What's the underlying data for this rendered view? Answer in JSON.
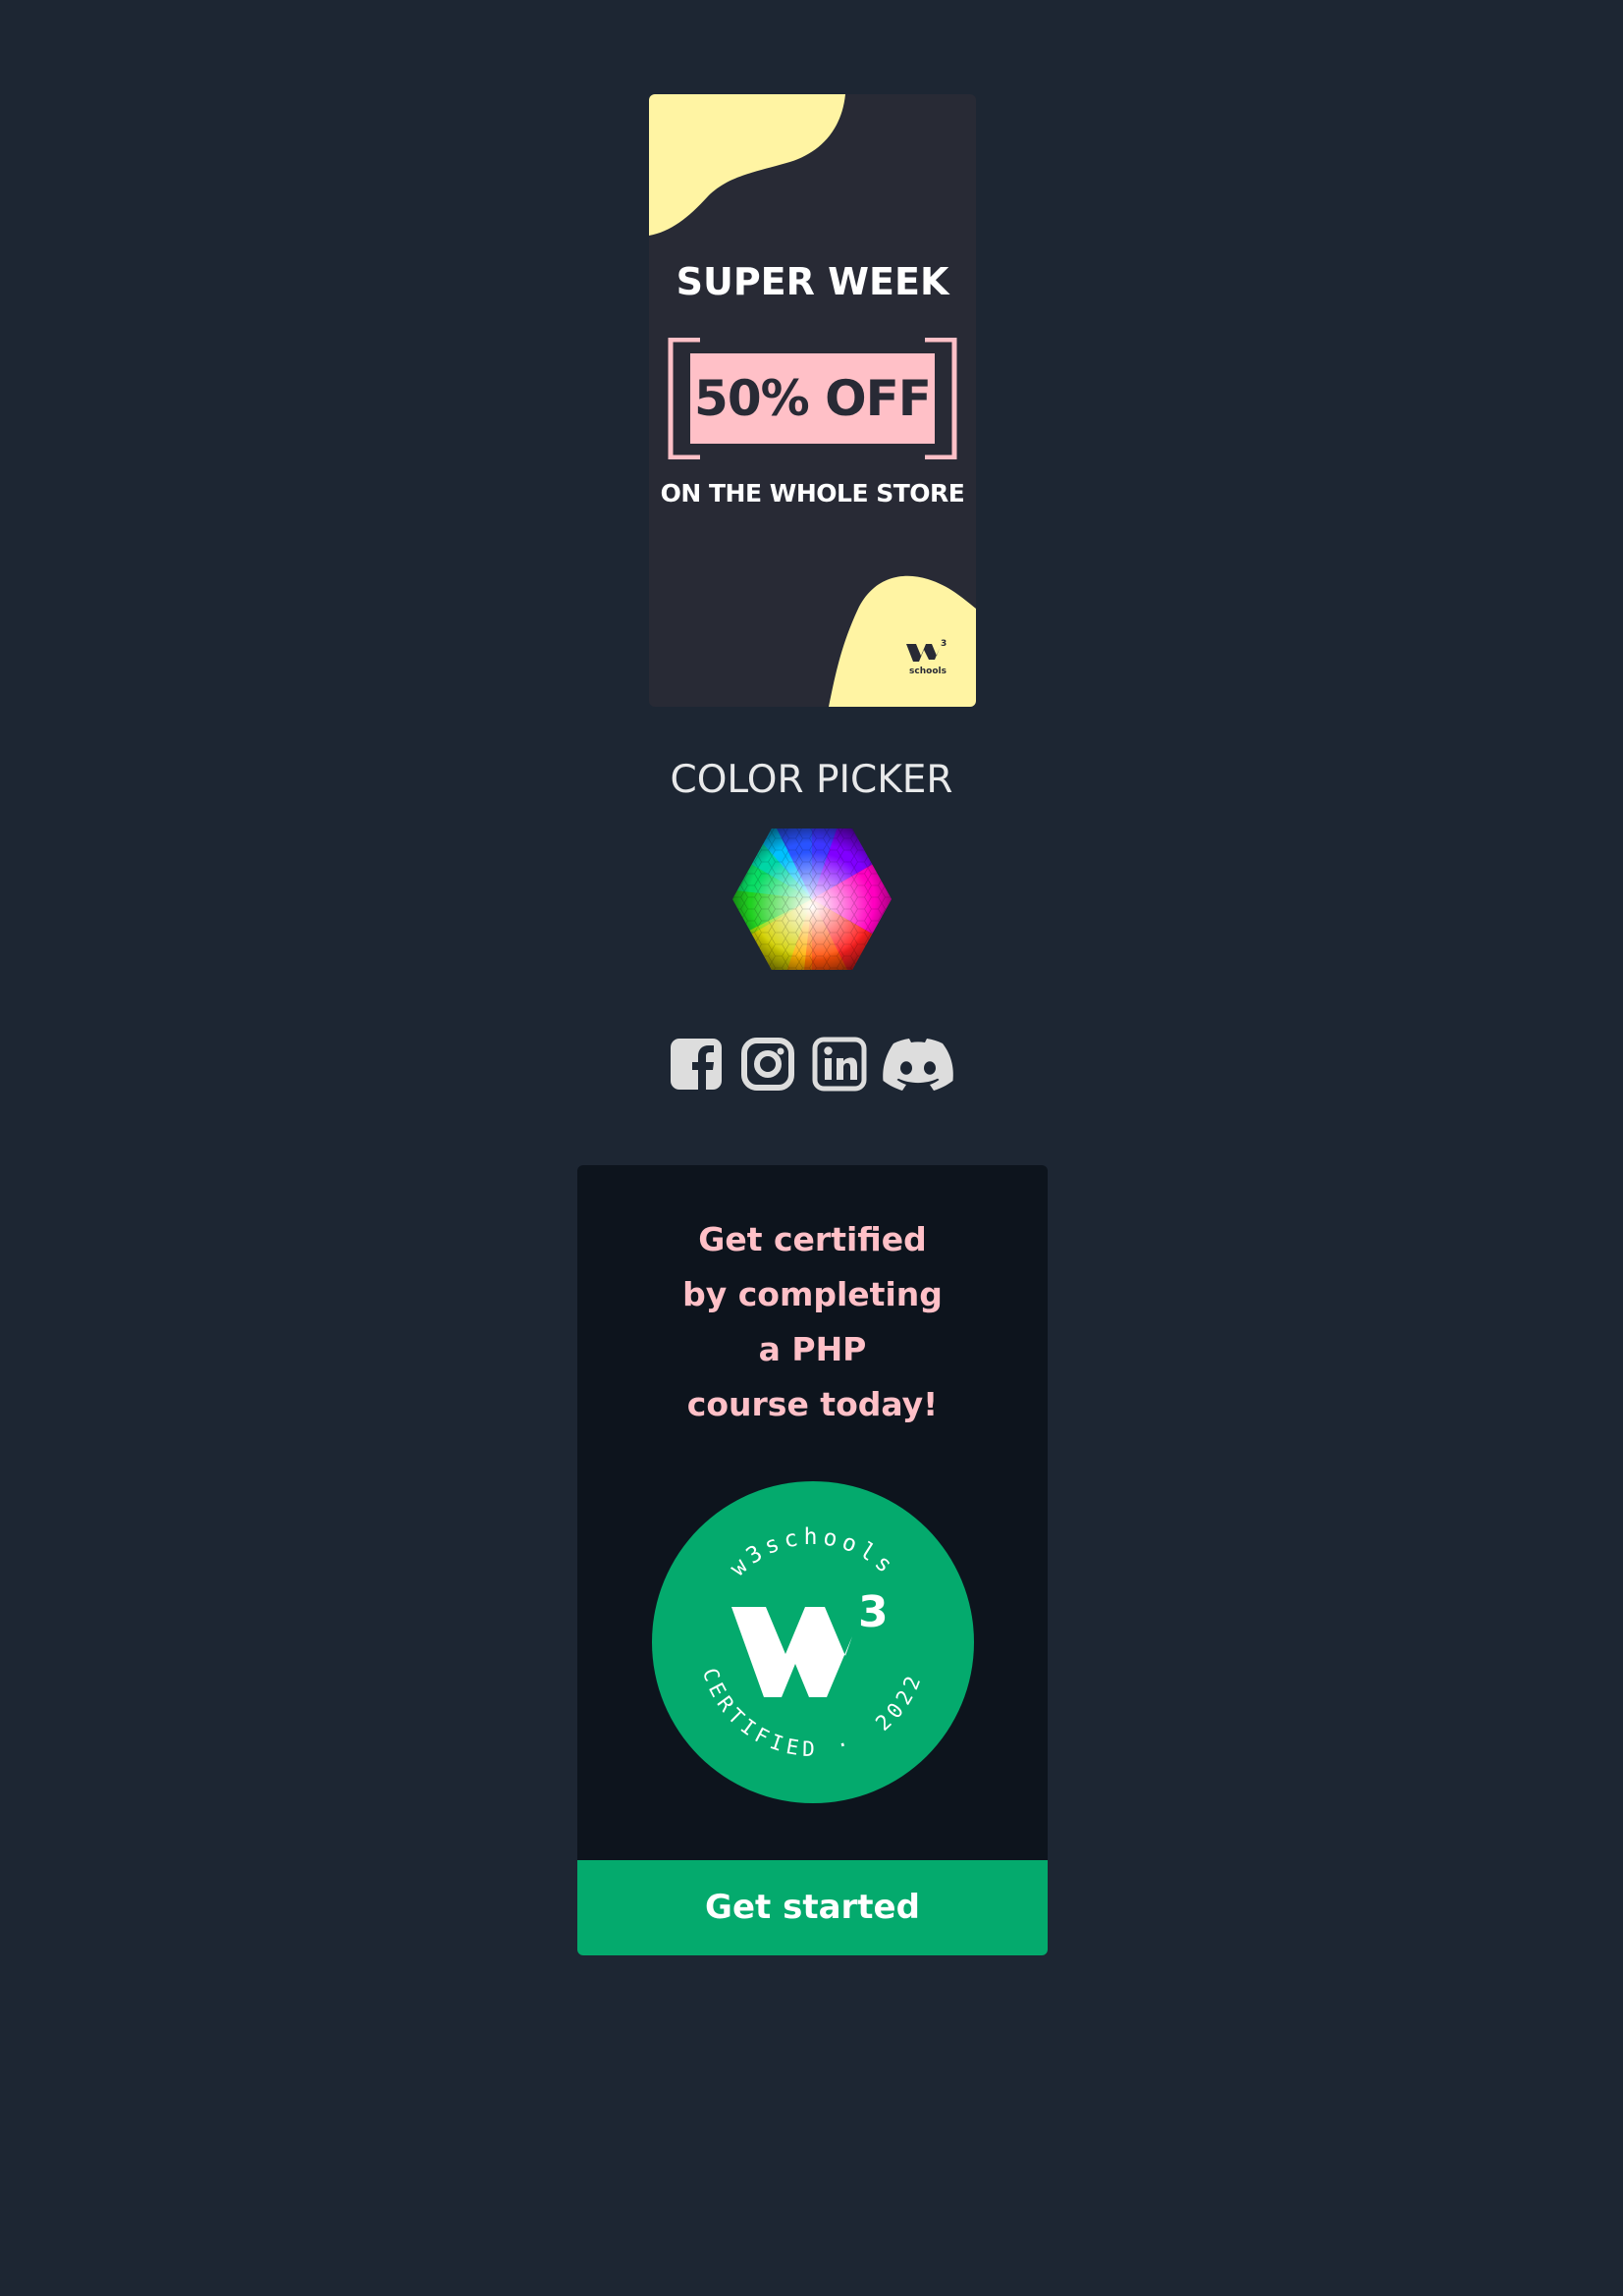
{
  "ad": {
    "headline": "SUPER WEEK",
    "discount": "50% OFF",
    "subline": "ON THE WHOLE STORE",
    "logo_text": "schools",
    "logo_sup": "3",
    "colors": {
      "background": "#282a35",
      "accent_yellow": "#fff4a3",
      "discount_bg": "#ffc0c7",
      "frame": "#ffc0c7"
    }
  },
  "color_picker": {
    "title": "COLOR PICKER",
    "icon": "color-hexagon-icon"
  },
  "social": {
    "items": [
      {
        "name": "facebook",
        "icon": "facebook-icon"
      },
      {
        "name": "instagram",
        "icon": "instagram-icon"
      },
      {
        "name": "linkedin",
        "icon": "linkedin-icon"
      },
      {
        "name": "discord",
        "icon": "discord-icon"
      }
    ],
    "color": "#dddddd"
  },
  "certificate": {
    "lines": [
      "Get certified",
      "by completing",
      "a PHP",
      "course today!"
    ],
    "badge": {
      "top_text": "w3schools",
      "bottom_left_text": "CERTIFIED",
      "separator": "·",
      "bottom_right_text": "2022",
      "logo_sup": "3",
      "color": "#04aa6d"
    },
    "button_label": "Get started",
    "colors": {
      "card_bg": "#0d141d",
      "text": "#ffc0c7",
      "button_bg": "#04aa6d"
    }
  },
  "page": {
    "background": "#1d2633"
  }
}
